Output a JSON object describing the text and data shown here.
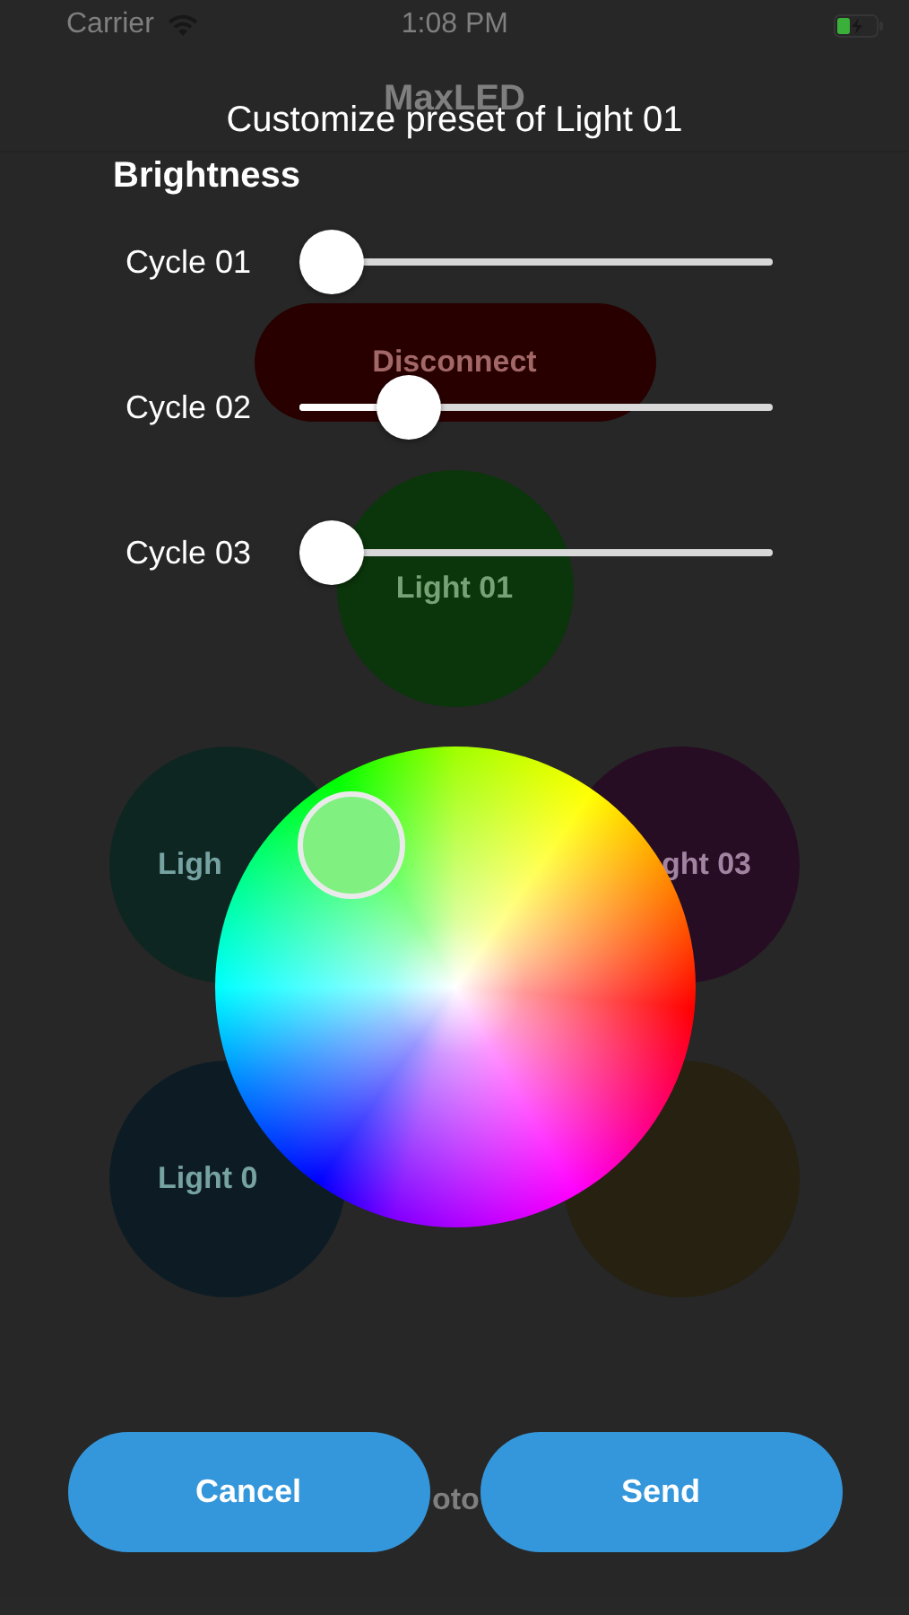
{
  "status_bar": {
    "carrier": "Carrier",
    "time": "1:08 PM"
  },
  "background": {
    "title": "MaxLED",
    "disconnect_button": "Disconnect",
    "lights": [
      {
        "label": "Light 01",
        "color": "#0c3a0c"
      },
      {
        "label": "Ligh",
        "color": "#102a24"
      },
      {
        "label": "ght 03",
        "color": "#2a0f26"
      },
      {
        "label": "Light 0",
        "color": "#0f1f28"
      },
      {
        "color": "#2a2412"
      }
    ],
    "footer_text": "oto"
  },
  "dialog": {
    "title": "Customize preset of Light 01",
    "section": "Brightness",
    "sliders": [
      {
        "label": "Cycle 01",
        "level": 0.0
      },
      {
        "label": "Cycle 02",
        "level": 0.19
      },
      {
        "label": "Cycle 03",
        "level": 0.0
      }
    ],
    "buttons": [
      "Cancel",
      "Send"
    ]
  }
}
